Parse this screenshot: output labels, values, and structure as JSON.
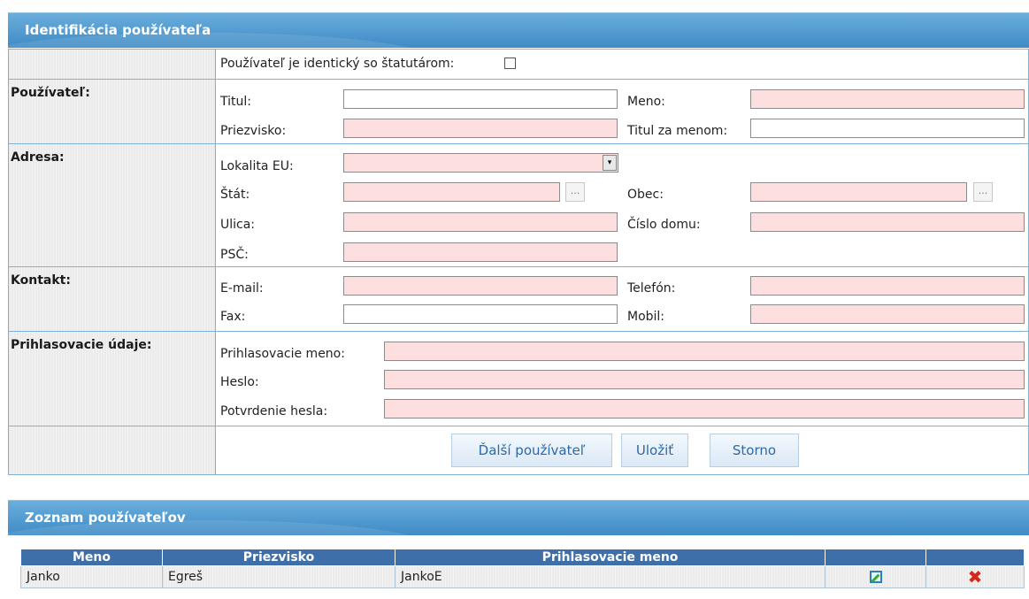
{
  "identification": {
    "title": "Identifikácia používateľa",
    "same_as_statutory_label": "Používateľ je identický so štatutárom:",
    "same_as_statutory_checked": false
  },
  "user_section": {
    "label": "Používateľ:",
    "title_label": "Titul:",
    "title_value": "",
    "first_name_label": "Meno:",
    "first_name_value": "",
    "last_name_label": "Priezvisko:",
    "last_name_value": "",
    "title_after_label": "Titul za menom:",
    "title_after_value": ""
  },
  "address_section": {
    "label": "Adresa:",
    "eu_locality_label": "Lokalita EU:",
    "eu_locality_value": "",
    "state_label": "Štát:",
    "state_value": "",
    "city_label": "Obec:",
    "city_value": "",
    "street_label": "Ulica:",
    "street_value": "",
    "house_number_label": "Číslo domu:",
    "house_number_value": "",
    "zip_label": "PSČ:",
    "zip_value": "",
    "lookup_glyph": "..."
  },
  "contact_section": {
    "label": "Kontakt:",
    "email_label": "E-mail:",
    "email_value": "",
    "phone_label": "Telefón:",
    "phone_value": "",
    "fax_label": "Fax:",
    "fax_value": "",
    "mobile_label": "Mobil:",
    "mobile_value": ""
  },
  "login_section": {
    "label": "Prihlasovacie údaje:",
    "username_label": "Prihlasovacie meno:",
    "username_value": "",
    "password_label": "Heslo:",
    "password_value": "",
    "confirm_password_label": "Potvrdenie hesla:",
    "confirm_password_value": ""
  },
  "actions": {
    "next_user": "Ďalší používateľ",
    "save": "Uložiť",
    "cancel": "Storno"
  },
  "user_list": {
    "title": "Zoznam používateľov",
    "columns": {
      "first_name": "Meno",
      "last_name": "Priezvisko",
      "username": "Prihlasovacie meno"
    },
    "rows": [
      {
        "first_name": "Janko",
        "last_name": "Egreš",
        "username": "JankoE"
      }
    ]
  },
  "icons": {
    "edit": "edit-icon",
    "delete": "delete-icon",
    "dropdown": "chevron-down-icon"
  },
  "colors": {
    "header_blue": "#4f97cf",
    "table_header_blue": "#3f6fa8",
    "required_field": "#fddfdf",
    "button_text": "#2c69a8"
  }
}
